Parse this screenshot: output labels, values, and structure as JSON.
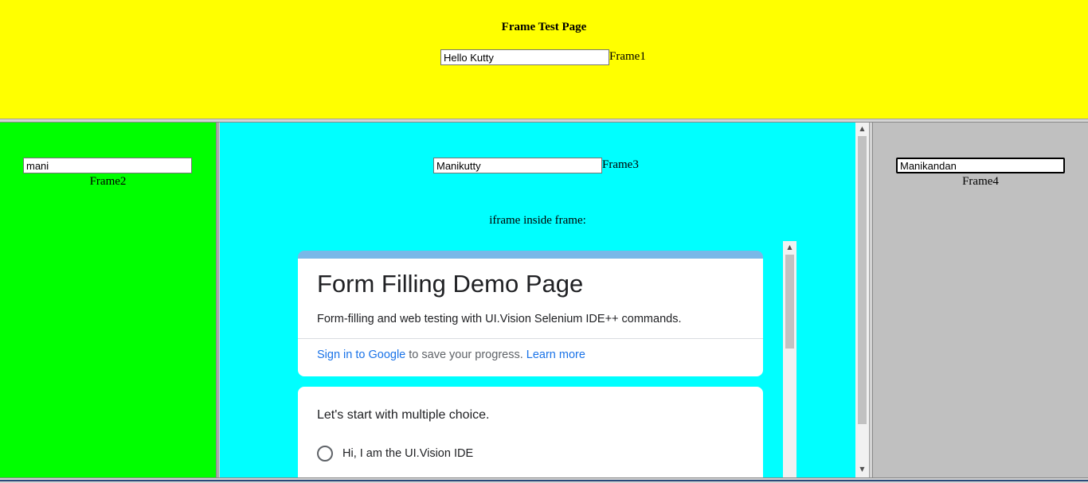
{
  "frame1": {
    "title": "Frame Test Page",
    "input_value": "Hello Kutty",
    "label": "Frame1"
  },
  "frame2": {
    "input_value": "mani",
    "label": "Frame2"
  },
  "frame3": {
    "input_value": "Manikutty",
    "label": "Frame3",
    "iframe_caption": "iframe inside frame:"
  },
  "frame4": {
    "input_value": "Manikandan",
    "label": "Frame4"
  },
  "form": {
    "title": "Form Filling Demo Page",
    "description": "Form-filling and web testing with UI.Vision Selenium IDE++ commands.",
    "signin_link": "Sign in to Google",
    "signin_rest": " to save your progress. ",
    "learn_more": "Learn more",
    "question": "Let's start with multiple choice.",
    "option1": "Hi, I am the UI.Vision IDE"
  },
  "colors": {
    "frame1_bg": "#ffff00",
    "frame2_bg": "#00ff00",
    "frame3_bg": "#00ffff",
    "frame4_bg": "#c0c0c0",
    "form_accent": "#79b8e8",
    "link": "#1a73e8"
  },
  "icons": [
    "scroll-up-arrow-icon",
    "scroll-down-arrow-icon",
    "radio-unchecked-icon"
  ]
}
